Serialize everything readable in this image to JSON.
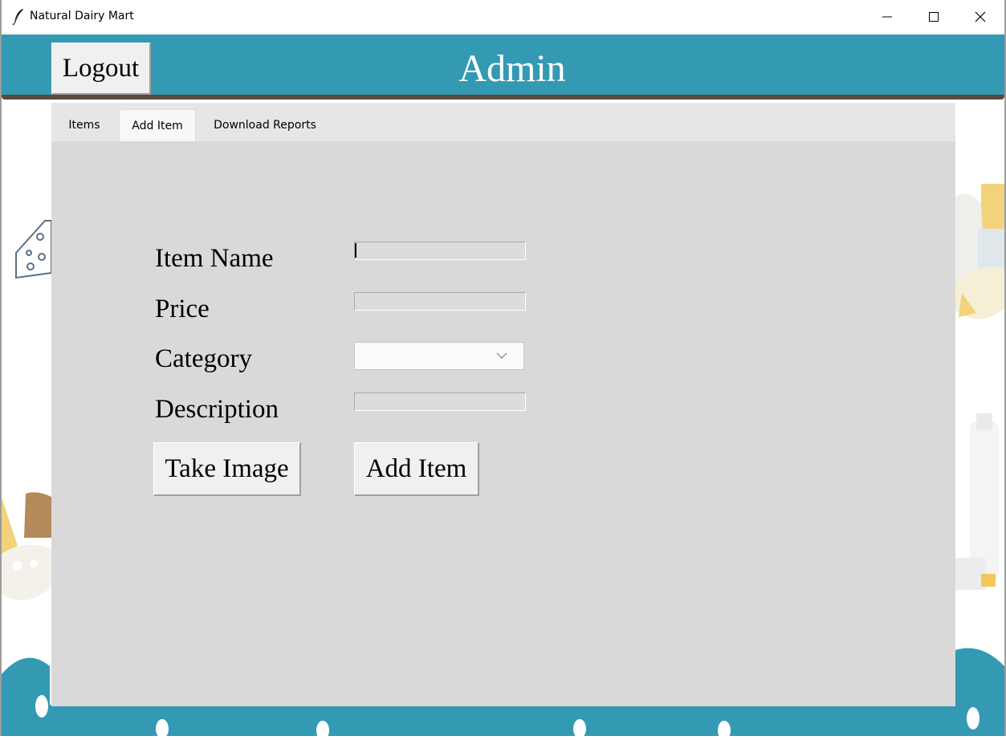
{
  "window": {
    "title": "Natural Dairy Mart",
    "icons": [
      "feather-icon",
      "minimize-icon",
      "maximize-icon",
      "close-icon"
    ]
  },
  "header": {
    "logout_label": "Logout",
    "title": "Admin",
    "background": "#3499b3"
  },
  "tabs": [
    {
      "label": "Items",
      "selected": false
    },
    {
      "label": "Add Item",
      "selected": true
    },
    {
      "label": "Download Reports",
      "selected": false
    }
  ],
  "form": {
    "item_name_label": "Item Name",
    "item_name_value": "",
    "price_label": "Price",
    "price_value": "",
    "category_label": "Category",
    "category_value": "",
    "description_label": "Description",
    "description_value": ""
  },
  "buttons": {
    "take_image": "Take Image",
    "add_item": "Add Item"
  },
  "colors": {
    "panel": "#d9d9d9",
    "tabbar": "#e6e6e6",
    "wave": "#3499b3"
  }
}
